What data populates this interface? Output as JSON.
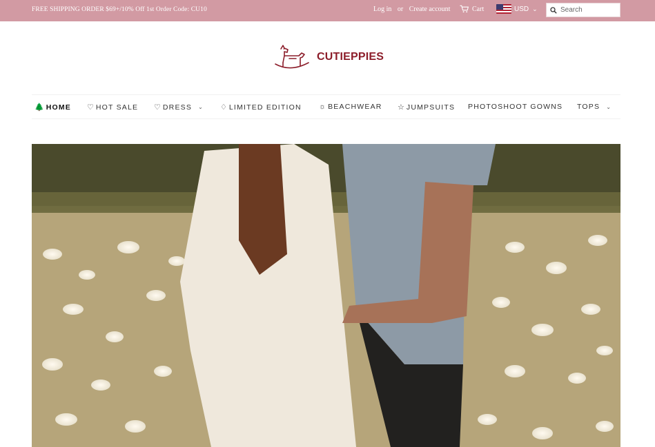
{
  "topbar": {
    "promo": "FREE SHIPPING ORDER $69+/10% Off 1st Order Code: CU10",
    "login": "Log in",
    "or": "or",
    "create_account": "Create account",
    "cart": "Cart",
    "currency": "USD",
    "search_placeholder": "Search"
  },
  "brand": {
    "name": "CUTIEPPIES",
    "color": "#8c1d2a",
    "logo_icon": "rocking-horse-icon"
  },
  "nav": {
    "items": [
      {
        "label": "HOME",
        "icon": "tree-icon",
        "active": true
      },
      {
        "label": "HOT SALE",
        "icon": "heart-icon"
      },
      {
        "label": "DRESS",
        "icon": "heart-icon",
        "dropdown": true
      },
      {
        "label": "LIMITED EDITION",
        "icon": "diamond-icon"
      },
      {
        "label": "BEACHWEAR",
        "icon": "sun-icon"
      },
      {
        "label": "JUMPSUITS",
        "icon": "star-icon"
      },
      {
        "label": "PHOTOSHOOT GOWNS"
      },
      {
        "label": "TOPS",
        "dropdown": true
      }
    ]
  },
  "colors": {
    "topbar_bg": "#d29aa3",
    "accent": "#8c1d2a"
  }
}
